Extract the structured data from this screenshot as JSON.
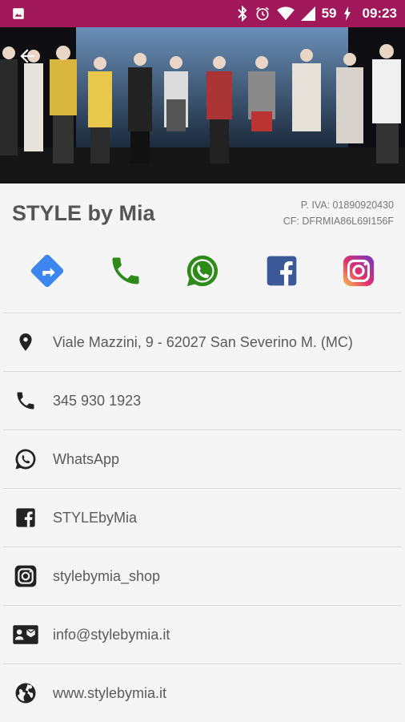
{
  "status_bar": {
    "battery": "59",
    "time": "09:23",
    "icons": [
      "image-notification-icon",
      "bluetooth-icon",
      "alarm-icon",
      "wifi-icon",
      "signal-icon",
      "battery-charging-icon"
    ]
  },
  "hero": {
    "back_icon": "arrow-back-icon"
  },
  "shop": {
    "title": "STYLE by Mia",
    "vat": "P. IVA: 01890920430",
    "tax_code": "CF: DFRMIA86L69I156F"
  },
  "actions": [
    {
      "icon": "directions-icon",
      "color": "#3d86f0"
    },
    {
      "icon": "phone-icon",
      "color": "#2e8b1a"
    },
    {
      "icon": "whatsapp-icon",
      "color": "#2e8b1a"
    },
    {
      "icon": "facebook-icon",
      "color": "#3b5998"
    },
    {
      "icon": "instagram-icon",
      "color": "#c13584"
    }
  ],
  "contacts": [
    {
      "icon": "location-icon",
      "text": "Viale Mazzini, 9 - 62027 San Severino M. (MC)"
    },
    {
      "icon": "phone-icon",
      "text": "345 930 1923"
    },
    {
      "icon": "whatsapp-icon",
      "text": "WhatsApp"
    },
    {
      "icon": "facebook-icon",
      "text": "STYLEbyMia"
    },
    {
      "icon": "instagram-icon",
      "text": "stylebymia_shop"
    },
    {
      "icon": "contact-card-icon",
      "text": "info@stylebymia.it"
    },
    {
      "icon": "globe-icon",
      "text": "www.stylebymia.it"
    }
  ],
  "colors": {
    "status_bar": "#a0185a",
    "background": "#f5f5f5",
    "text": "#5a5a5a",
    "divider": "#d9d9d9"
  }
}
